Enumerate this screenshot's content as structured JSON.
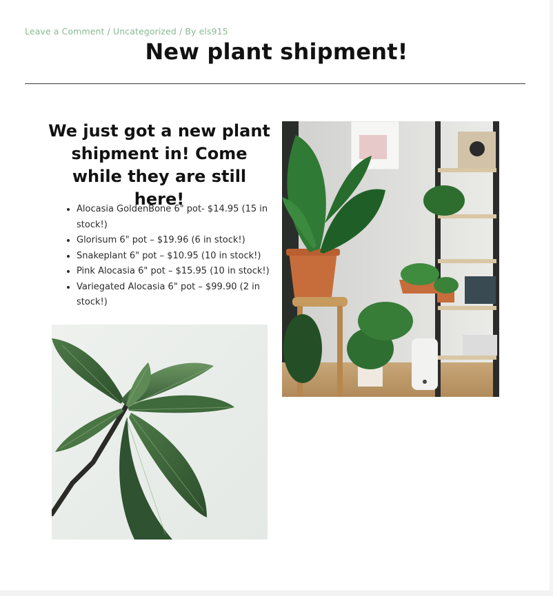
{
  "post": {
    "meta": {
      "comment_link": "Leave a Comment",
      "separator_1": " / ",
      "category": "Uncategorized",
      "separator_2": " / ",
      "author_prefix": "By ",
      "author": "els915"
    },
    "title": "New plant shipment!",
    "subheading": "We just got a new plant shipment in! Come while they are still here!",
    "stock_items": [
      "Alocasia GoldenBone 6\" pot- $14.95 (15 in stock!)",
      "Glorisum 6\" pot – $19.96 (6 in stock!)",
      "Snakeplant 6\" pot – $10.95 (10 in stock!)",
      "Pink Alocasia 6\" pot – $15.95 (10 in stock!)",
      "Variegated Alocasia 6\" pot – $99.90 (2 in stock!)"
    ]
  },
  "colors": {
    "meta_link": "#8ab894",
    "title": "#111111",
    "rule": "#3a3a3a",
    "body_text": "#2a2a2a"
  }
}
